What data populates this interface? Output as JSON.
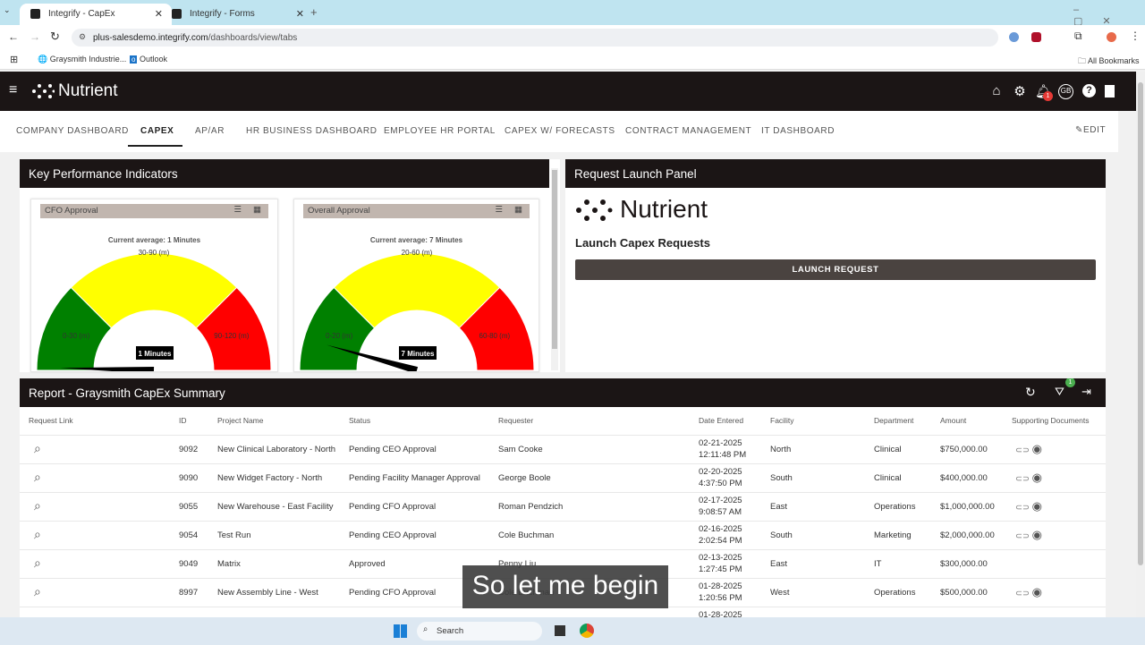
{
  "browser": {
    "tabs": [
      {
        "title": "Integrify - CapEx"
      },
      {
        "title": "Integrify - Forms"
      }
    ],
    "url_host": "plus-salesdemo.integrify.com",
    "url_path": "/dashboards/view/tabs",
    "bookmarks": [
      "Graysmith Industrie...",
      "Outlook"
    ],
    "all_bookmarks": "All Bookmarks"
  },
  "app": {
    "brand": "Nutrient",
    "notification_count": "1",
    "avatar": "GB",
    "edit_label": "EDIT",
    "nav_tabs": [
      "COMPANY DASHBOARD",
      "CAPEX",
      "AP/AR",
      "HR BUSINESS DASHBOARD",
      "EMPLOYEE HR PORTAL",
      "CAPEX W/ FORECASTS",
      "CONTRACT MANAGEMENT",
      "IT DASHBOARD"
    ],
    "active_tab": "CAPEX"
  },
  "kpi": {
    "title": "Key Performance Indicators",
    "gauges": [
      {
        "title": "CFO Approval",
        "average": "Current average: 1 Minutes",
        "value": 1,
        "max": 120,
        "needle_label": "1 Minutes",
        "bands": [
          {
            "label": "0-30 (m)",
            "from": 0,
            "to": 30,
            "color": "#008000"
          },
          {
            "label": "30-90 (m)",
            "from": 30,
            "to": 90,
            "color": "#ffff00"
          },
          {
            "label": "90-120 (m)",
            "from": 90,
            "to": 120,
            "color": "#ff0000"
          }
        ]
      },
      {
        "title": "Overall Approval",
        "average": "Current average: 7 Minutes",
        "value": 7,
        "max": 80,
        "needle_label": "7 Minutes",
        "bands": [
          {
            "label": "0-20 (m)",
            "from": 0,
            "to": 20,
            "color": "#008000"
          },
          {
            "label": "20-60 (m)",
            "from": 20,
            "to": 60,
            "color": "#ffff00"
          },
          {
            "label": "60-80 (m)",
            "from": 60,
            "to": 80,
            "color": "#ff0000"
          }
        ]
      }
    ]
  },
  "launch": {
    "title": "Request Launch Panel",
    "brand": "Nutrient",
    "heading": "Launch Capex Requests",
    "button": "LAUNCH REQUEST"
  },
  "report": {
    "title": "Report - Graysmith CapEx Summary",
    "filter_count": "1",
    "columns": [
      "Request Link",
      "ID",
      "Project Name",
      "Status",
      "Requester",
      "Date Entered",
      "Facility",
      "Department",
      "Amount",
      "Supporting Documents"
    ],
    "rows": [
      [
        "9092",
        "New Clinical Laboratory - North",
        "Pending CEO Approval",
        "Sam Cooke",
        "02-21-2025 12:11:48 PM",
        "North",
        "Clinical",
        "$750,000.00",
        true
      ],
      [
        "9090",
        "New Widget Factory - North",
        "Pending Facility Manager Approval",
        "George Boole",
        "02-20-2025 4:37:50 PM",
        "South",
        "Clinical",
        "$400,000.00",
        true
      ],
      [
        "9055",
        "New Warehouse - East Facility",
        "Pending CFO Approval",
        "Roman Pendzich",
        "02-17-2025 9:08:57 AM",
        "East",
        "Operations",
        "$1,000,000.00",
        true
      ],
      [
        "9054",
        "Test Run",
        "Pending CEO Approval",
        "Cole Buchman",
        "02-16-2025 2:02:54 PM",
        "South",
        "Marketing",
        "$2,000,000.00",
        true
      ],
      [
        "9049",
        "Matrix",
        "Approved",
        "Penny Liu",
        "02-13-2025 1:27:45 PM",
        "East",
        "IT",
        "$300,000.00",
        false
      ],
      [
        "8997",
        "New Assembly Line - West",
        "Pending CFO Approval",
        "Cole Buchman",
        "01-28-2025 1:20:56 PM",
        "West",
        "Operations",
        "$500,000.00",
        true
      ],
      [
        "",
        "",
        "",
        "",
        "01-28-2025",
        "",
        "",
        "",
        false
      ]
    ]
  },
  "caption": "So let me begin",
  "taskbar": {
    "search": "Search"
  }
}
